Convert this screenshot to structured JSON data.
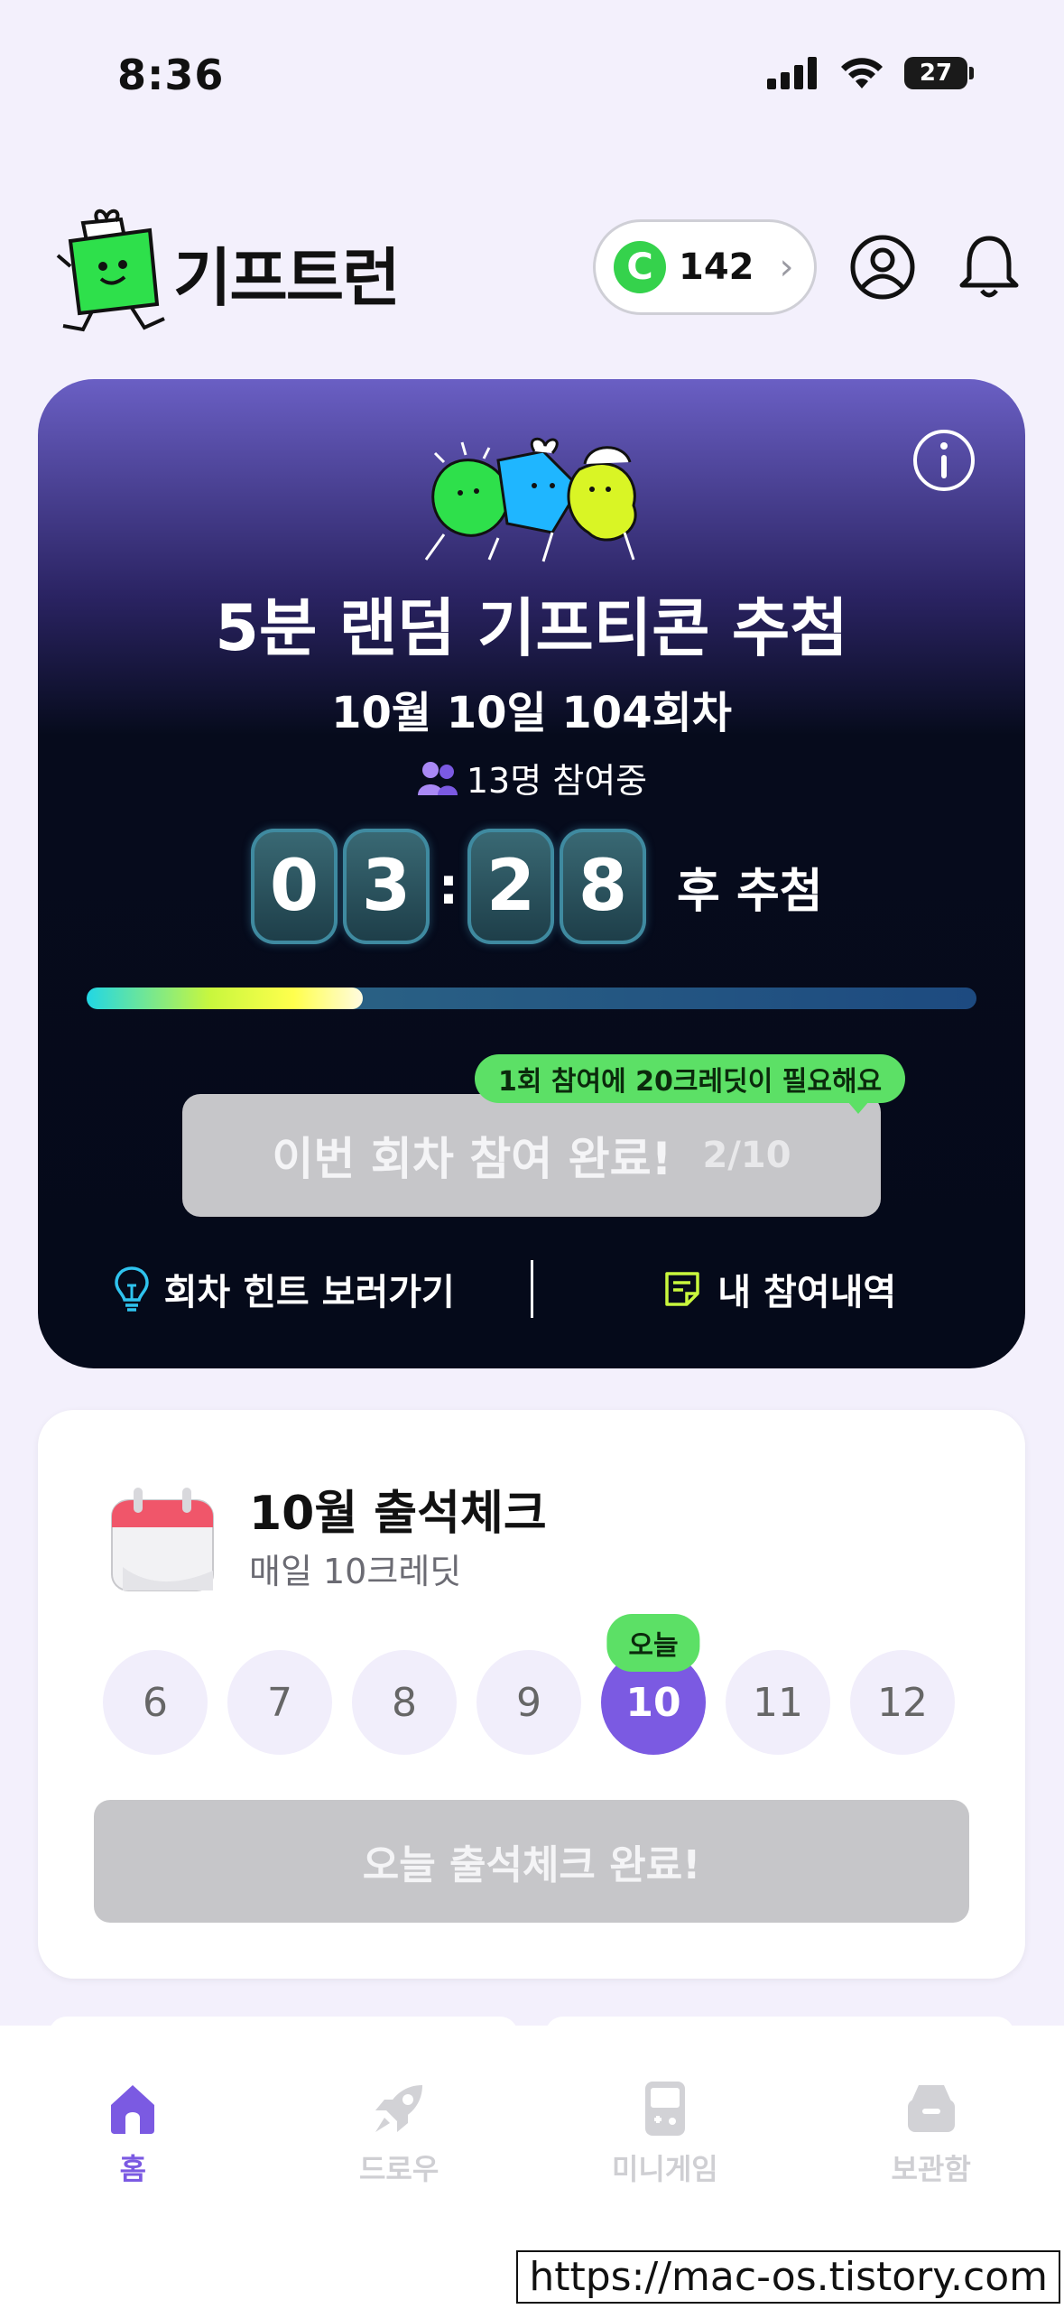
{
  "status_bar": {
    "time": "8:36",
    "battery": "27"
  },
  "header": {
    "logo_text": "기프트런",
    "credits": "142",
    "credit_coin_letter": "C"
  },
  "lottery": {
    "title": "5분 랜덤 기프티콘 추첨",
    "round": "10월 10일 104회차",
    "participants": "13명 참여중",
    "timer": {
      "d1": "0",
      "d2": "3",
      "d3": "2",
      "d4": "8",
      "suffix": "후 추첨"
    },
    "progress": 0.31,
    "tooltip": "1회 참여에 20크레딧이 필요해요",
    "join_label": "이번 회차 참여 완료!",
    "join_count": "2/10",
    "hint_link": "회차 힌트 보러가기",
    "history_link": "내 참여내역"
  },
  "attendance": {
    "title": "10월 출석체크",
    "subtitle": "매일 10크레딧",
    "days": [
      "6",
      "7",
      "8",
      "9",
      "10",
      "11",
      "12"
    ],
    "today_index": 4,
    "today_badge": "오늘",
    "button": "오늘 출석체크 완료!"
  },
  "nav": [
    {
      "label": "홈",
      "icon": "home-icon"
    },
    {
      "label": "드로우",
      "icon": "rocket-icon"
    },
    {
      "label": "미니게임",
      "icon": "gameboy-icon"
    },
    {
      "label": "보관함",
      "icon": "storage-box-icon"
    }
  ],
  "watermark": "https://mac-os.tistory.com",
  "colors": {
    "accent": "#7b5ae2",
    "green": "#5ce066",
    "card_dark": "#050a1a"
  }
}
